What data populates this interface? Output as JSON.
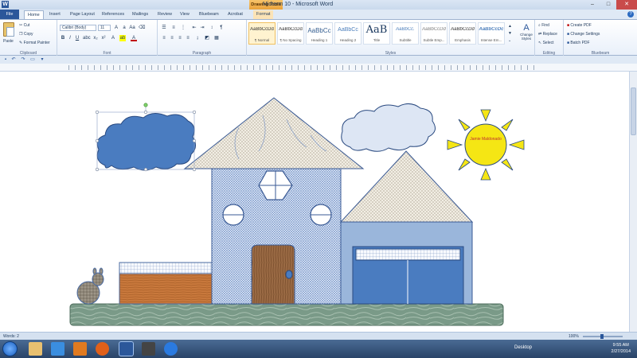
{
  "window": {
    "title": "Midterm 10 - Microsoft Word",
    "context_tab_group": "Drawing Tools",
    "minimize_icon": "minimize-icon",
    "maximize_icon": "maximize-icon",
    "close_icon": "close-icon"
  },
  "tabs": [
    {
      "label": "File"
    },
    {
      "label": "Home"
    },
    {
      "label": "Insert"
    },
    {
      "label": "Page Layout"
    },
    {
      "label": "References"
    },
    {
      "label": "Mailings"
    },
    {
      "label": "Review"
    },
    {
      "label": "View"
    },
    {
      "label": "Bluebeam"
    },
    {
      "label": "Acrobat"
    },
    {
      "label": "Format"
    }
  ],
  "ribbon": {
    "clipboard": {
      "label": "Clipboard",
      "paste": "Paste",
      "cut": "Cut",
      "copy": "Copy",
      "format_painter": "Format Painter"
    },
    "font": {
      "label": "Font",
      "font_name": "Calibri (Body)",
      "font_size": "11"
    },
    "paragraph": {
      "label": "Paragraph"
    },
    "styles": {
      "label": "Styles",
      "items": [
        {
          "sample": "AaBbCcDd",
          "name": "¶ Normal"
        },
        {
          "sample": "AaBbCcDd",
          "name": "¶ No Spacing"
        },
        {
          "sample": "AaBbCc",
          "name": "Heading 1"
        },
        {
          "sample": "AaBbCc",
          "name": "Heading 2"
        },
        {
          "sample": "AaB",
          "name": "Title"
        },
        {
          "sample": "AaBbCc.",
          "name": "Subtitle"
        },
        {
          "sample": "AaBbCcDd",
          "name": "Subtle Emp..."
        },
        {
          "sample": "AaBbCcDd",
          "name": "Emphasis"
        },
        {
          "sample": "AaBbCcDc",
          "name": "Intense Em..."
        }
      ],
      "change_styles": "Change Styles"
    },
    "editing": {
      "label": "Editing",
      "find": "Find",
      "replace": "Replace",
      "select": "Select"
    },
    "bluebeam": {
      "label": "Bluebeam",
      "create_pdf": "Create PDF",
      "change_settings": "Change Settings",
      "batch_pdf": "Batch PDF"
    }
  },
  "document": {
    "sun_label": "Jamie Maldonado"
  },
  "status": {
    "words": "Words: 2",
    "zoom": "100%"
  },
  "taskbar": {
    "desktop": "Desktop",
    "time": "9:55 AM",
    "date": "2/27/2014"
  },
  "colors": {
    "accent": "#2b579a",
    "cloud_selected": "#4a7cc0",
    "cloud_plain": "#dde6f4",
    "sun": "#f5e614",
    "ground": "#7a9a88",
    "garage": "#9ab6db",
    "garage_door": "#4a7cc0",
    "wood": "#c8783c"
  }
}
